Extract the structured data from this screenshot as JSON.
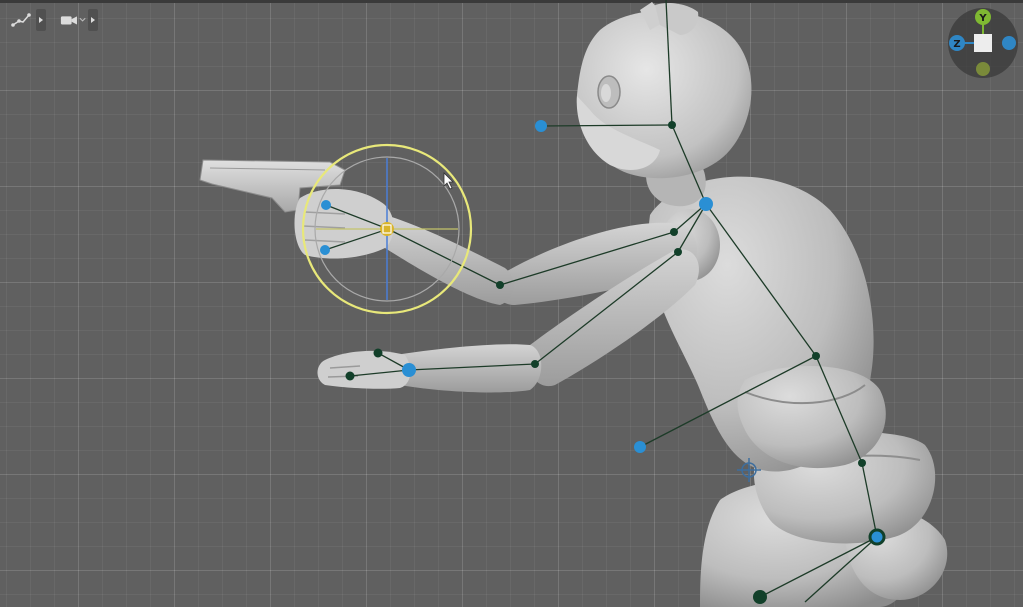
{
  "viewport": {
    "name": "3d-viewport",
    "grid": true
  },
  "toolbar": {
    "left": [
      {
        "icon": "bone-path-icon"
      },
      {
        "icon": "video-camera-icon"
      }
    ]
  },
  "orientation_gizmo": {
    "axes": [
      {
        "label": "Y",
        "color": "#7fb832"
      },
      {
        "label": "Z",
        "color": "#2f86c4"
      }
    ],
    "center_color": "#ededed"
  },
  "selection": {
    "active_joint_color": "#d9b429",
    "rotate_ring_color": "#e8e87a"
  },
  "colors": {
    "ik_handle": "#2a8fd4",
    "fk_joint": "#12402a",
    "bone_line": "#1d3b28",
    "model": "#bcbcbc"
  }
}
